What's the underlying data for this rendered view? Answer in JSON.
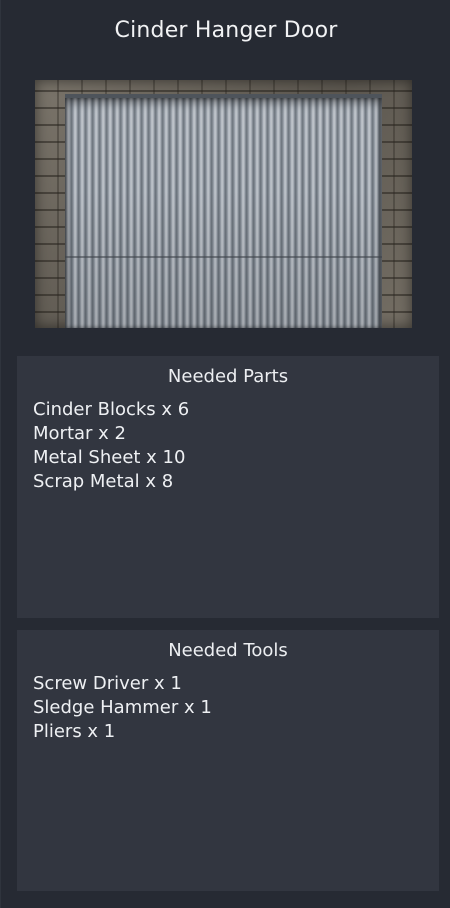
{
  "title": "Cinder Hanger Door",
  "preview": {
    "image_name": "cinder-hanger-door-preview"
  },
  "parts": {
    "heading": "Needed Parts",
    "items": [
      "Cinder Blocks x 6",
      "Mortar x 2",
      "Metal Sheet x 10",
      "Scrap Metal x 8"
    ]
  },
  "tools": {
    "heading": "Needed Tools",
    "items": [
      "Screw Driver x 1",
      "Sledge Hammer x 1",
      "Pliers x 1"
    ]
  },
  "colors": {
    "background": "#262a33",
    "panel": "#323640",
    "text": "#eef0f3"
  }
}
